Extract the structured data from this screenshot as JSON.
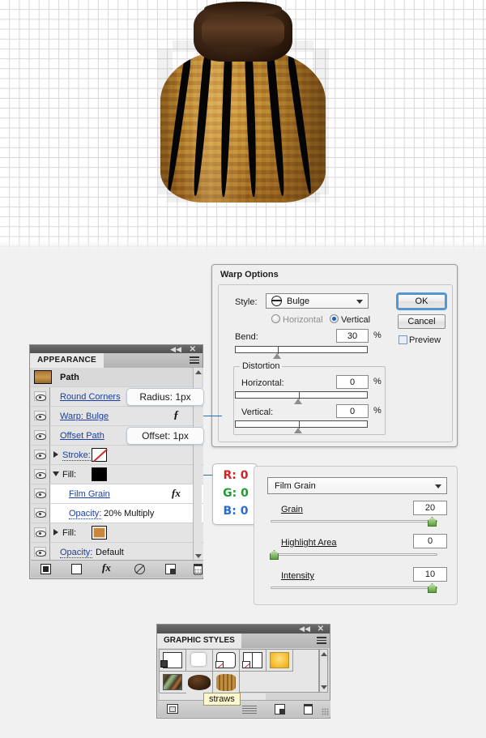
{
  "canvas": {
    "name": "artwork-canvas",
    "grid": true,
    "artwork_title": "straw-broom-illustration"
  },
  "warp_dialog": {
    "title": "Warp Options",
    "style_label": "Style:",
    "style_value": "Bulge",
    "orientation": {
      "horizontal": "Horizontal",
      "vertical": "Vertical",
      "selected": "Vertical"
    },
    "bend_label": "Bend:",
    "bend_value": "30",
    "bend_unit": "%",
    "distortion_legend": "Distortion",
    "distortion_h_label": "Horizontal:",
    "distortion_h_value": "0",
    "distortion_h_unit": "%",
    "distortion_v_label": "Vertical:",
    "distortion_v_value": "0",
    "distortion_v_unit": "%",
    "ok_label": "OK",
    "cancel_label": "Cancel",
    "preview_label": "Preview",
    "preview_checked": false
  },
  "appearance": {
    "tab_label": "APPEARANCE",
    "target_label": "Path",
    "rows": [
      {
        "label": "Round Corners",
        "kind": "effect"
      },
      {
        "label": "Warp: Bulge",
        "kind": "effect"
      },
      {
        "label": "Offset Path",
        "kind": "effect"
      },
      {
        "label": "Stroke:",
        "kind": "stroke",
        "swatch": "none"
      },
      {
        "label": "Fill:",
        "kind": "fill",
        "swatch": "#000000"
      },
      {
        "label": "Film Grain",
        "kind": "sub-effect"
      },
      {
        "label": "Opacity:",
        "kind": "opacity",
        "value": "20% Multiply"
      },
      {
        "label": "Fill:",
        "kind": "fill",
        "swatch": "#c8873a"
      },
      {
        "label": "Opacity:",
        "kind": "opacity",
        "value": "Default"
      }
    ],
    "toolbar": {
      "add_stroke": "add-new-stroke",
      "add_fill": "add-new-fill",
      "add_effect": "fx",
      "clear": "clear-appearance",
      "duplicate": "duplicate-item",
      "delete": "delete-item"
    }
  },
  "callouts": {
    "radius": "Radius: 1px",
    "offset": "Offset: 1px"
  },
  "rgb_box": {
    "r_label": "R: 0",
    "r_color": "#d42222",
    "g_label": "G: 0",
    "g_color": "#1f9c2f",
    "b_label": "B: 0",
    "b_color": "#2a6ccf"
  },
  "film_grain": {
    "effect_name": "Film Grain",
    "grain_label": "Grain",
    "grain_value": "20",
    "highlight_label": "Highlight Area",
    "highlight_value": "0",
    "intensity_label": "Intensity",
    "intensity_value": "10"
  },
  "graphic_styles": {
    "tab_label": "GRAPHIC STYLES",
    "tooltip": "straws",
    "swatches": [
      "default-style",
      "white-rounded",
      "no-fill-rounded",
      "split-no-fill",
      "yellow-gradient",
      "camo-texture",
      "dark-brown-cap",
      "straws-style"
    ],
    "toolbar": {
      "break_link": "break-link-to-style",
      "merge": "merge-styles",
      "new": "new-style",
      "delete": "delete-style"
    }
  }
}
